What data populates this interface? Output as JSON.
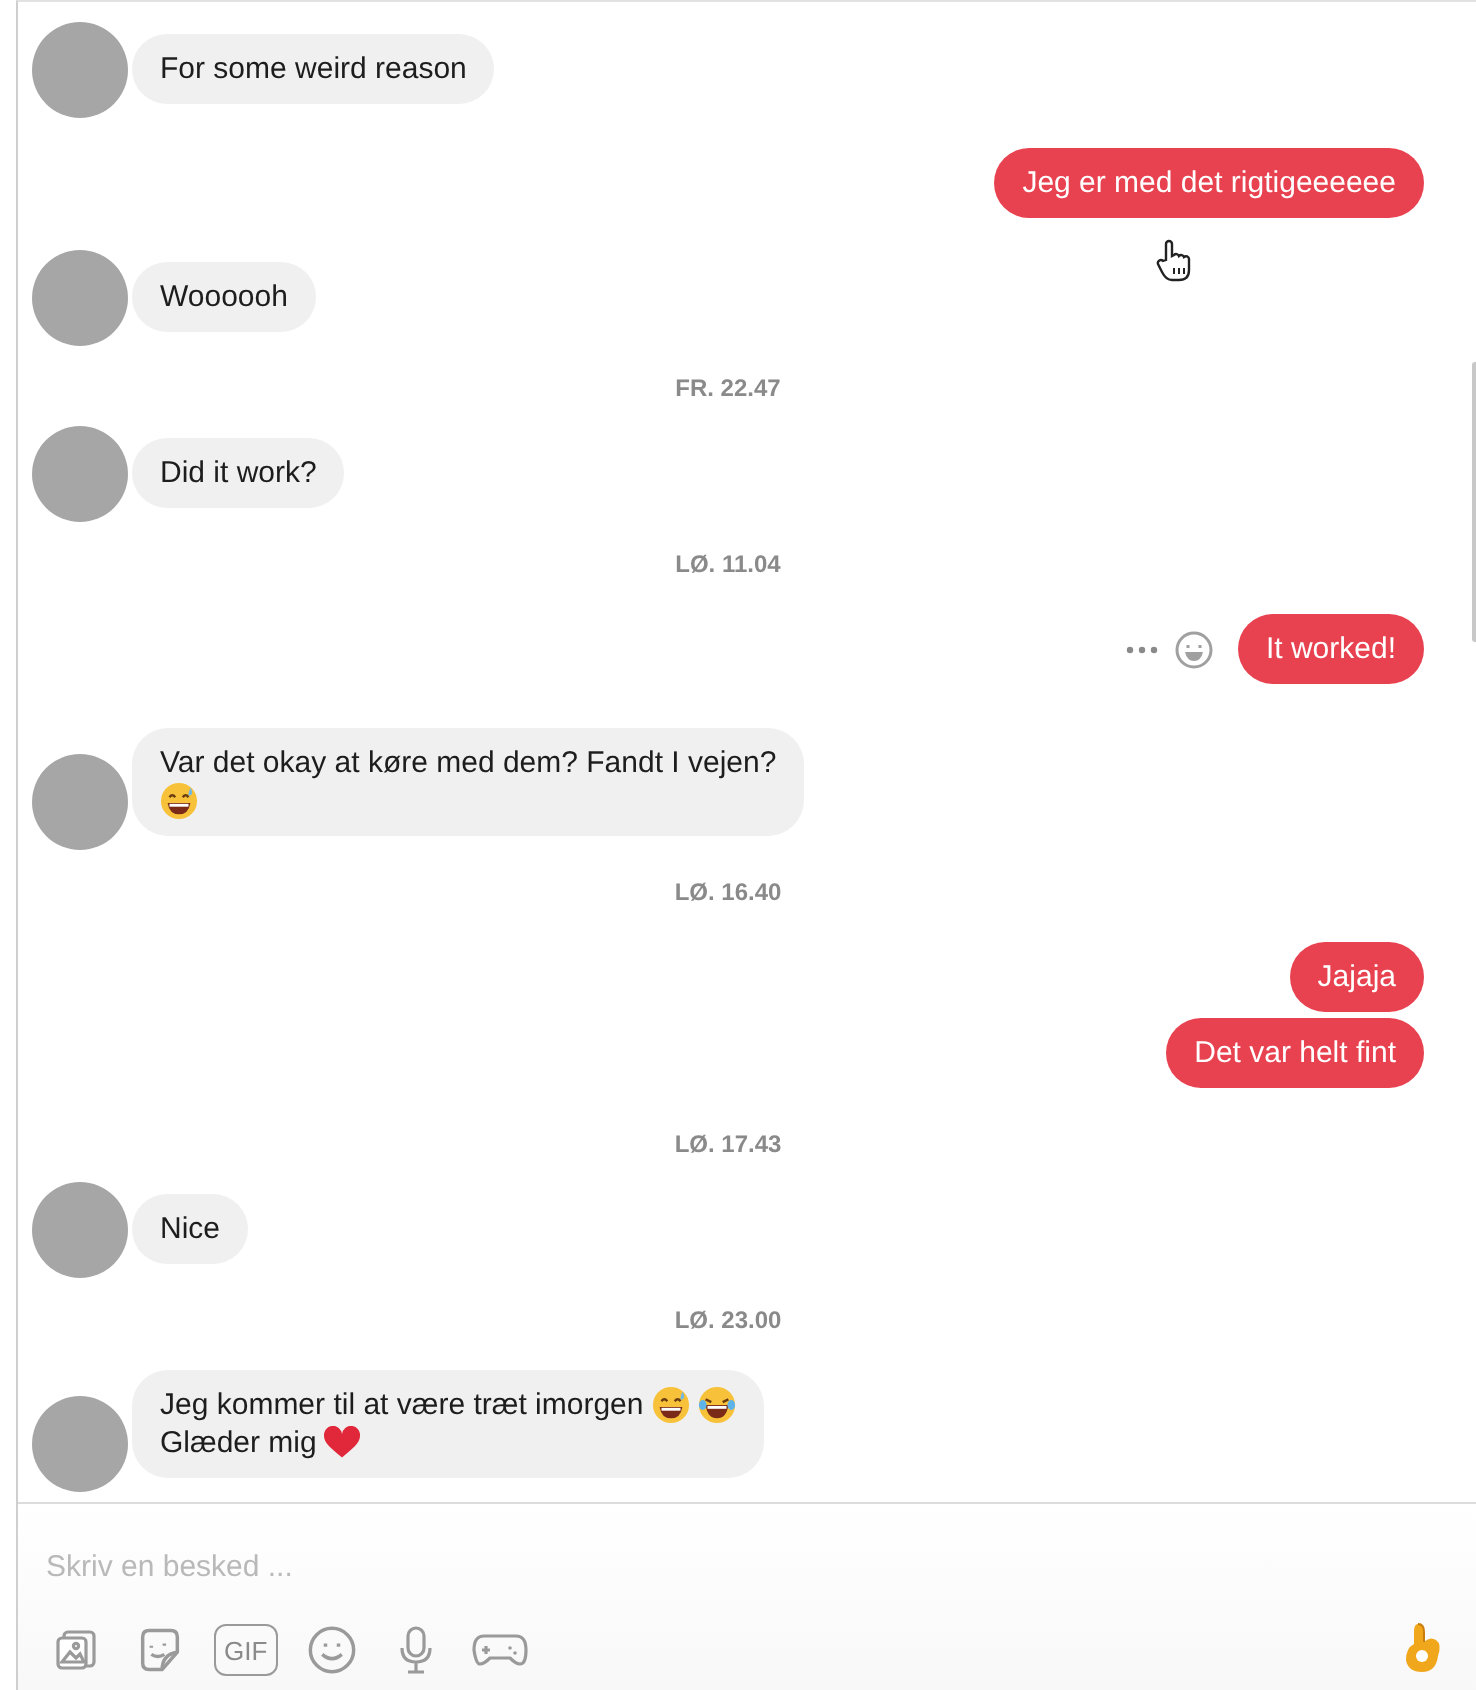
{
  "messages": [
    {
      "kind": "in",
      "avatar": true,
      "lines": [
        {
          "text": "For some weird reason"
        }
      ]
    },
    {
      "kind": "out",
      "lines": [
        {
          "text": "Jeg er med det rigtigeeeeee"
        }
      ]
    },
    {
      "kind": "in",
      "avatar": true,
      "lines": [
        {
          "text": "Woooooh"
        }
      ]
    },
    {
      "kind": "time",
      "text": "FR. 22.47"
    },
    {
      "kind": "in",
      "avatar": true,
      "lines": [
        {
          "text": "Did it work?"
        }
      ]
    },
    {
      "kind": "time",
      "text": "LØ. 11.04"
    },
    {
      "kind": "out",
      "hover_actions": true,
      "lines": [
        {
          "text": "It worked!"
        }
      ]
    },
    {
      "kind": "in",
      "avatar": true,
      "lines": [
        {
          "text": "Var det okay at køre med dem? Fandt I vejen?"
        },
        {
          "emoji": [
            {
              "kind": "grin-sweat"
            }
          ]
        }
      ]
    },
    {
      "kind": "time",
      "text": "LØ. 16.40"
    },
    {
      "kind": "out",
      "lines": [
        {
          "text": "Jajaja"
        }
      ]
    },
    {
      "kind": "out",
      "lines": [
        {
          "text": "Det var helt fint"
        }
      ]
    },
    {
      "kind": "time",
      "text": "LØ. 17.43"
    },
    {
      "kind": "in",
      "avatar": true,
      "lines": [
        {
          "text": "Nice"
        }
      ]
    },
    {
      "kind": "time",
      "text": "LØ. 23.00"
    },
    {
      "kind": "in",
      "avatar": true,
      "lines": [
        {
          "text": "Jeg kommer til at være træt imorgen",
          "emoji": [
            {
              "kind": "grin-sweat"
            },
            {
              "kind": "laugh-tears"
            }
          ]
        },
        {
          "text": "Glæder mig",
          "emoji": [
            {
              "kind": "heart"
            }
          ]
        }
      ]
    }
  ],
  "cursor": {
    "kind": "hand"
  },
  "composer": {
    "placeholder": "Skriv en besked ...",
    "tools": [
      {
        "kind": "photos"
      },
      {
        "kind": "sticker"
      },
      {
        "kind": "gif",
        "label": "GIF"
      },
      {
        "kind": "emoji"
      },
      {
        "kind": "mic"
      },
      {
        "kind": "game"
      }
    ],
    "send": {
      "kind": "ok-hand"
    }
  }
}
